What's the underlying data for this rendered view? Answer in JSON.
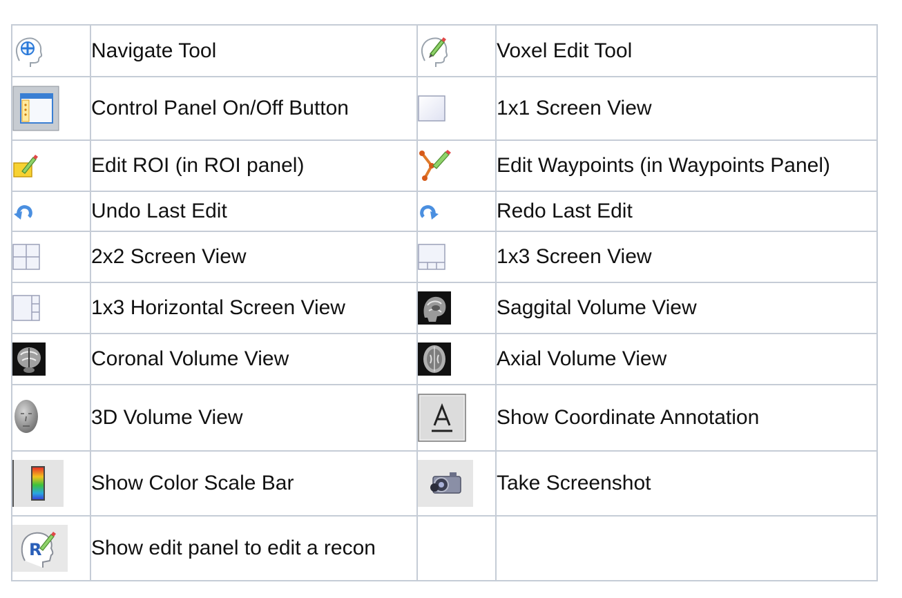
{
  "rows": [
    [
      {
        "icon": "navigate-head-icon",
        "label": "Navigate Tool"
      },
      {
        "icon": "voxel-edit-head-icon",
        "label": "Voxel Edit Tool"
      }
    ],
    [
      {
        "icon": "control-panel-icon",
        "label": "Control Panel On/Off Button"
      },
      {
        "icon": "single-view-icon",
        "label": "1x1 Screen View"
      }
    ],
    [
      {
        "icon": "edit-roi-icon",
        "label": "Edit ROI (in ROI panel)"
      },
      {
        "icon": "edit-waypoints-icon",
        "label": "Edit Waypoints (in Waypoints Panel)"
      }
    ],
    [
      {
        "icon": "undo-icon",
        "label": "Undo Last Edit"
      },
      {
        "icon": "redo-icon",
        "label": "Redo Last Edit"
      }
    ],
    [
      {
        "icon": "grid-2x2-icon",
        "label": "2x2 Screen View"
      },
      {
        "icon": "grid-1x3-icon",
        "label": "1x3 Screen View"
      }
    ],
    [
      {
        "icon": "grid-1x3-horizontal-icon",
        "label": "1x3 Horizontal Screen View"
      },
      {
        "icon": "sagittal-mri-icon",
        "label": "Saggital Volume View"
      }
    ],
    [
      {
        "icon": "coronal-mri-icon",
        "label": "Coronal Volume View"
      },
      {
        "icon": "axial-mri-icon",
        "label": "Axial Volume View"
      }
    ],
    [
      {
        "icon": "3d-head-icon",
        "label": "3D Volume View"
      },
      {
        "icon": "annotation-a-icon",
        "label": "Show Coordinate Annotation"
      }
    ],
    [
      {
        "icon": "color-scale-bar-icon",
        "label": "Show Color Scale Bar"
      },
      {
        "icon": "camera-icon",
        "label": "Take Screenshot"
      }
    ],
    [
      {
        "icon": "recon-edit-head-icon",
        "label": "Show edit panel to edit a recon"
      },
      {
        "icon": "",
        "label": ""
      }
    ]
  ]
}
